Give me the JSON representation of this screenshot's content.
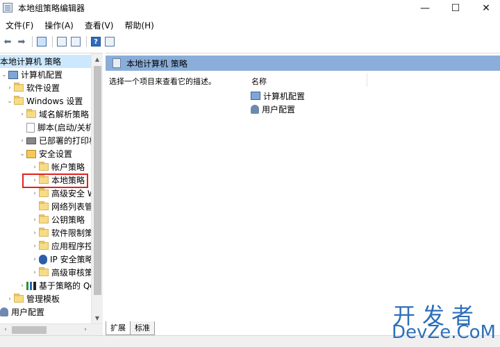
{
  "window": {
    "title": "本地组策略编辑器",
    "minimize_glyph": "—",
    "maximize_glyph": "☐",
    "close_glyph": "✕"
  },
  "menu": [
    {
      "label": "文件(F)"
    },
    {
      "label": "操作(A)"
    },
    {
      "label": "查看(V)"
    },
    {
      "label": "帮助(H)"
    }
  ],
  "toolbar": {
    "back_glyph": "⬅",
    "forward_glyph": "➡",
    "help_glyph": "?",
    "icons": [
      "back-icon",
      "forward-icon",
      "show-hide-tree-icon",
      "properties-icon",
      "export-icon",
      "help-icon",
      "view-icon"
    ]
  },
  "tree": {
    "items": [
      {
        "label": "本地计算机 策略"
      },
      {
        "label": "计算机配置"
      },
      {
        "label": "软件设置"
      },
      {
        "label": "Windows 设置"
      },
      {
        "label": "域名解析策略"
      },
      {
        "label": "脚本(启动/关机"
      },
      {
        "label": "已部署的打印机"
      },
      {
        "label": "安全设置"
      },
      {
        "label": "帐户策略"
      },
      {
        "label": "本地策略"
      },
      {
        "label": "高级安全 W"
      },
      {
        "label": "网络列表管理"
      },
      {
        "label": "公钥策略"
      },
      {
        "label": "软件限制策略"
      },
      {
        "label": "应用程序控制"
      },
      {
        "label": "IP 安全策略"
      },
      {
        "label": "高级审核策略"
      },
      {
        "label": "基于策略的 Qo"
      },
      {
        "label": "管理模板"
      },
      {
        "label": "用户配置"
      }
    ],
    "collapsed_chevron": "›",
    "expanded_chevron": "⌄",
    "scroll_up": "▲",
    "scroll_down": "▼",
    "scroll_left": "‹",
    "scroll_right": "›"
  },
  "right_pane": {
    "header": "本地计算机 策略",
    "description": "选择一个项目来查看它的描述。",
    "column_name": "名称",
    "items": [
      {
        "label": "计算机配置"
      },
      {
        "label": "用户配置"
      }
    ]
  },
  "tabs": [
    {
      "label": "扩展"
    },
    {
      "label": "标准"
    }
  ],
  "watermark": {
    "cn": "开发者",
    "en": "DevZe.CoM"
  },
  "colors": {
    "header_bar": "#8aaed9",
    "selection": "#cce8ff",
    "highlight_border": "#e02020",
    "watermark": "#2d6fb8"
  }
}
